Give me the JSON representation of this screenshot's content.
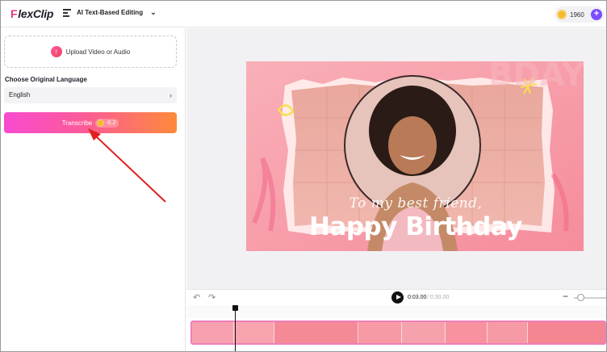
{
  "header": {
    "logo_prefix": "F",
    "logo_text": "lexClip",
    "mode_label": "AI Text-Based Editing",
    "credits": "1960"
  },
  "left_panel": {
    "upload_label": "Upload Video or Audio",
    "language_label": "Choose Original Language",
    "language_value": "English",
    "transcribe_label": "Transcribe",
    "transcribe_cost": "-0.2"
  },
  "canvas": {
    "subtitle": "To my best friend,",
    "title": "Happy Birthday"
  },
  "transport": {
    "current_time": "0:03.00",
    "total_time": "/ 0:30.00"
  },
  "colors": {
    "accent": "#7c4dff",
    "brand": "#e23b8c",
    "annotation_arrow": "#e02020",
    "canvas_pink": "#f7a2ad"
  }
}
